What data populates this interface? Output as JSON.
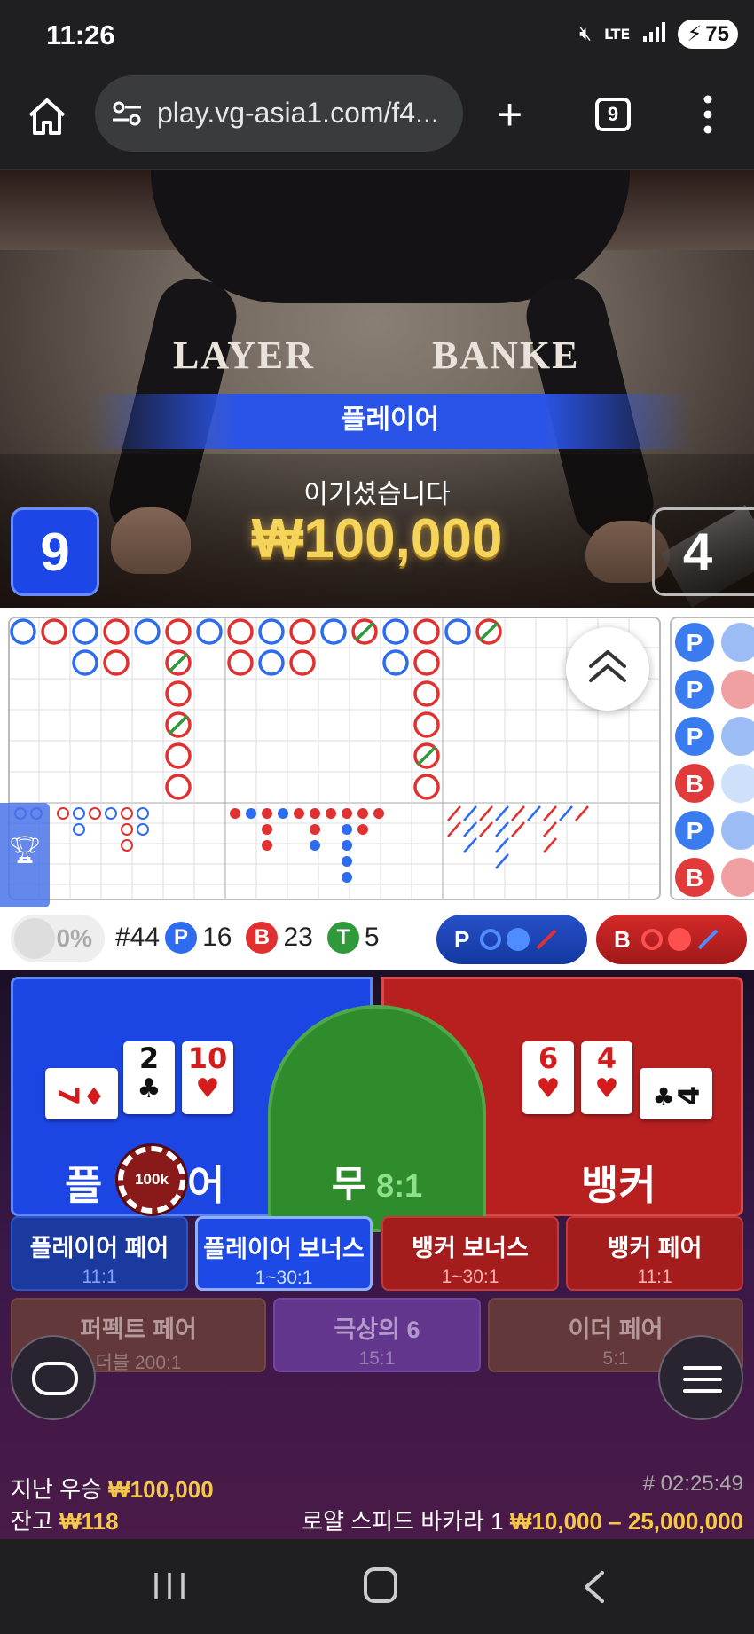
{
  "status_bar": {
    "time": "11:26",
    "signal": "LTE",
    "battery": "75"
  },
  "browser": {
    "url": "play.vg-asia1.com/f4...",
    "tab_count": "9"
  },
  "video": {
    "table_left_text": "LAYER",
    "table_right_text": "BANKE",
    "winner_banner": "플레이어",
    "won_label": "이기셨습니다",
    "won_amount": "₩100,000",
    "player_score": "9",
    "banker_score": "4"
  },
  "roadmap": {
    "side_road": [
      "P",
      "P",
      "P",
      "B",
      "P",
      "B"
    ],
    "big_road_note": "bead patterns",
    "stats": {
      "percent": "0%",
      "round": "#44",
      "p_label": "P",
      "p_count": "16",
      "b_label": "B",
      "b_count": "23",
      "t_label": "T",
      "t_count": "5"
    },
    "ask_player": "P",
    "ask_banker": "B"
  },
  "bet": {
    "player_label": "플레이어",
    "player_label_left": "플",
    "player_label_right": "어",
    "tie_label": "무",
    "tie_odds": "8:1",
    "banker_label": "뱅커",
    "chip": "100k",
    "player_cards": [
      {
        "rank": "7",
        "suit": "♦",
        "color": "red",
        "horizontal": true
      },
      {
        "rank": "2",
        "suit": "♣",
        "color": "black",
        "horizontal": false
      },
      {
        "rank": "10",
        "suit": "♥",
        "color": "red",
        "horizontal": false
      }
    ],
    "banker_cards": [
      {
        "rank": "6",
        "suit": "♥",
        "color": "red",
        "horizontal": false
      },
      {
        "rank": "4",
        "suit": "♥",
        "color": "red",
        "horizontal": false
      },
      {
        "rank": "4",
        "suit": "♣",
        "color": "black",
        "horizontal": true
      }
    ],
    "side_bets": [
      {
        "name": "플레이어 페어",
        "odds": "11:1"
      },
      {
        "name": "플레이어 보너스",
        "odds": "1~30:1"
      },
      {
        "name": "뱅커 보너스",
        "odds": "1~30:1"
      },
      {
        "name": "뱅커 페어",
        "odds": "11:1"
      },
      {
        "name": "퍼펙트 페어",
        "odds": "더블 200:1"
      },
      {
        "name": "극상의 6",
        "odds": "15:1"
      },
      {
        "name": "이더 페어",
        "odds": "5:1"
      }
    ]
  },
  "footer": {
    "last_win_label": "지난 우승",
    "last_win_value": "₩100,000",
    "balance_label": "잔고",
    "balance_value": "₩118",
    "round_time": "# 02:25:49",
    "table_name": "로얄 스피드 바카라 1",
    "limits": "₩10,000 – 25,000,000"
  }
}
